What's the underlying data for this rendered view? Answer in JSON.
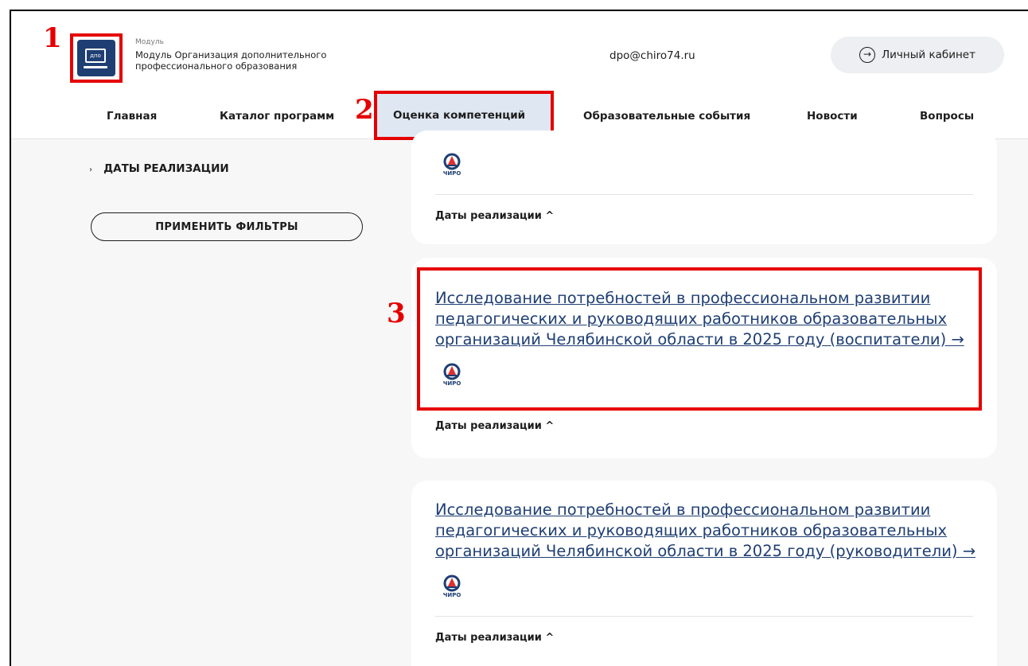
{
  "header": {
    "logo_text": "дпо",
    "module_small": "Модуль",
    "module_title": "Модуль Организация дополнительного профессионального образования",
    "email": "dpo@chiro74.ru",
    "cabinet_label": "Личный кабинет"
  },
  "nav": {
    "items": [
      {
        "label": "Главная"
      },
      {
        "label": "Каталог программ"
      },
      {
        "label": "Оценка компетенций"
      },
      {
        "label": "Образовательные события"
      },
      {
        "label": "Новости"
      },
      {
        "label": "Вопросы"
      }
    ]
  },
  "annotations": [
    "1",
    "2",
    "3"
  ],
  "sidebar": {
    "filter_label": "ДАТЫ РЕАЛИЗАЦИИ",
    "apply_label": "ПРИМЕНИТЬ ФИЛЬТРЫ"
  },
  "cards": [
    {
      "title": "",
      "org": "ЧИРО",
      "dates_label": "Даты реализации ^"
    },
    {
      "title": "Исследование потребностей в профессиональном развитии педагогических и руководящих работников образовательных организаций Челябинской области в 2025 году (воспитатели) →",
      "org": "ЧИРО",
      "dates_label": "Даты реализации ^"
    },
    {
      "title": "Исследование потребностей в профессиональном развитии педагогических и руководящих работников образовательных организаций Челябинской области в 2025 году (руководители) →",
      "org": "ЧИРО",
      "dates_label": "Даты реализации ^"
    }
  ],
  "colors": {
    "accent": "#1f3f73",
    "annotation": "#e50000"
  }
}
